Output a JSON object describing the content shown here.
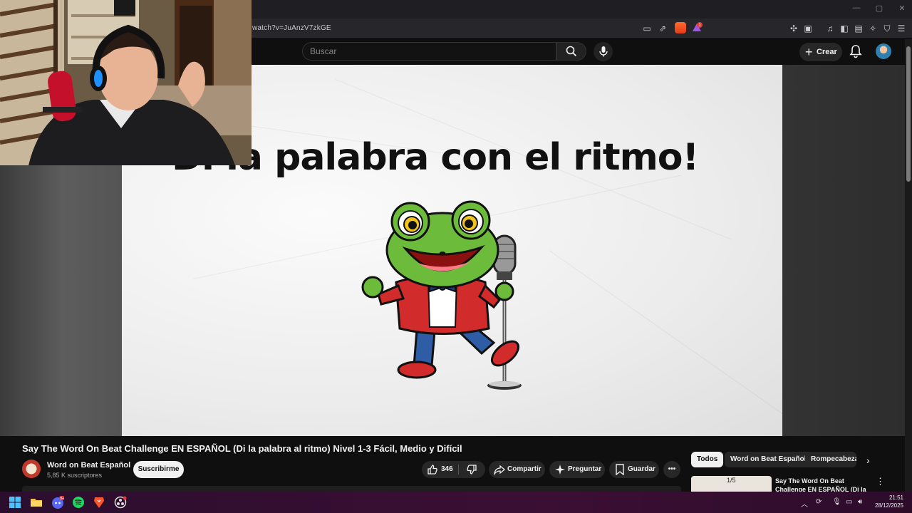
{
  "browser": {
    "url": "watch?v=JuAnzV7zkGE",
    "window_controls": [
      "—",
      "▢",
      "✕"
    ],
    "brave_badge_count": "1"
  },
  "youtube": {
    "search_placeholder": "Buscar",
    "create_label": "Crear"
  },
  "video_frame": {
    "headline": "Di la palabra con el ritmo!"
  },
  "video": {
    "title": "Say The Word On Beat Challenge EN ESPAÑOL (Di la palabra al ritmo) Nivel 1-3 Fácil, Medio y Difícil",
    "channel_name": "Word on Beat Español",
    "subscribers": "5,85 K suscriptores",
    "subscribe_label": "Suscribirme",
    "like_count": "346",
    "share_label": "Compartir",
    "ask_label": "Preguntar",
    "save_label": "Guardar"
  },
  "sidebar": {
    "chips": [
      "Todos",
      "Word on Beat Español",
      "Rompecabeza"
    ],
    "recommendation": {
      "title": "Say The Word On Beat Challenge EN ESPAÑOL (Di la",
      "pager": "1/5"
    }
  },
  "taskbar": {
    "time": "21:51",
    "date": "28/12/2025",
    "discord_badge": "9+"
  },
  "colors": {
    "accent_red": "#cc0000",
    "background": "#0f0f0f",
    "taskbar": "#3b0f34"
  }
}
